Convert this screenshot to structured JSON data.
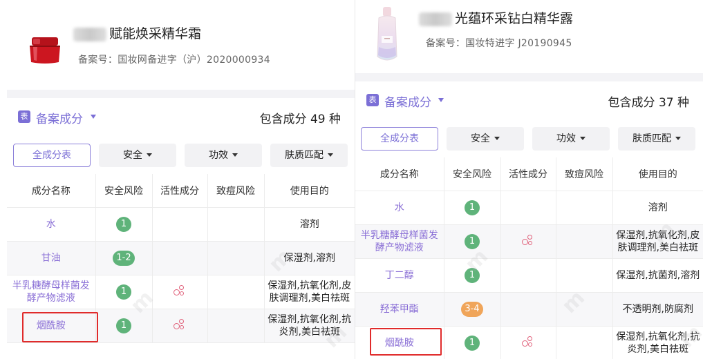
{
  "left": {
    "product": {
      "name": "赋能焕采精华霜",
      "registration": "备案号：国妆网备进字（沪）2020000934"
    },
    "section": {
      "icon_label": "表",
      "title": "备案成分",
      "count_text": "包含成分 49 种"
    },
    "filters": [
      "全成分表",
      "安全",
      "功效",
      "肤质匹配"
    ],
    "columns": [
      "成分名称",
      "安全风险",
      "活性成分",
      "致痘风险",
      "使用目的"
    ],
    "rows": [
      {
        "name": "水",
        "risk": "1",
        "risk_level": "green",
        "active": false,
        "purpose": "溶剂"
      },
      {
        "name": "甘油",
        "risk": "1-2",
        "risk_level": "green",
        "active": false,
        "purpose": "保湿剂,溶剂"
      },
      {
        "name": "半乳糖酵母样菌发酵产物滤液",
        "risk": "1",
        "risk_level": "green",
        "active": true,
        "purpose": "保湿剂,抗氧化剂,皮肤调理剂,美白祛斑"
      },
      {
        "name": "烟酰胺",
        "risk": "1",
        "risk_level": "green",
        "active": true,
        "purpose": "保湿剂,抗氧化剂,抗炎剂,美白祛斑"
      }
    ]
  },
  "right": {
    "product": {
      "name": "光蕴环采钻白精华露",
      "registration": "备案号：国妆特进字 J20190945"
    },
    "section": {
      "icon_label": "表",
      "title": "备案成分",
      "count_text": "包含成分 37 种"
    },
    "filters": [
      "全成分表",
      "安全",
      "功效",
      "肤质匹配"
    ],
    "columns": [
      "成分名称",
      "安全风险",
      "活性成分",
      "致痘风险",
      "使用目的"
    ],
    "rows": [
      {
        "name": "水",
        "risk": "1",
        "risk_level": "green",
        "active": false,
        "purpose": "溶剂"
      },
      {
        "name": "半乳糖酵母样菌发酵产物滤液",
        "risk": "1",
        "risk_level": "green",
        "active": true,
        "purpose": "保湿剂,抗氧化剂,皮肤调理剂,美白祛斑"
      },
      {
        "name": "丁二醇",
        "risk": "1",
        "risk_level": "green",
        "active": false,
        "purpose": "保湿剂,抗菌剂,溶剂"
      },
      {
        "name": "羟苯甲酯",
        "risk": "3-4",
        "risk_level": "orange",
        "active": false,
        "purpose": "不透明剂,防腐剂"
      },
      {
        "name": "烟酰胺",
        "risk": "1",
        "risk_level": "green",
        "active": true,
        "purpose": "保湿剂,抗氧化剂,抗炎剂,美白祛斑"
      }
    ]
  },
  "colors": {
    "accent": "#7b6fd6",
    "risk_green": "#5fb37a",
    "risk_orange": "#f0a55a",
    "highlight": "#e02b2b"
  }
}
